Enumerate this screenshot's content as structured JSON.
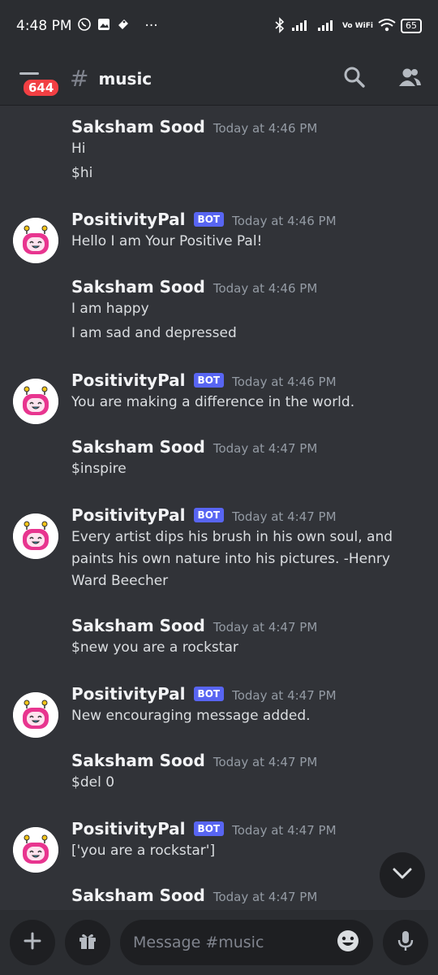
{
  "status_bar": {
    "time": "4:48 PM",
    "more": "···",
    "battery": "65",
    "vowifi": "Vo WiFi"
  },
  "header": {
    "unread_count": "644",
    "hash": "#",
    "channel": "music"
  },
  "messages": [
    {
      "author": "Saksham Sood",
      "bot": false,
      "time": "Today at 4:46 PM",
      "lines": [
        "Hi",
        "$hi"
      ]
    },
    {
      "author": "PositivityPal",
      "bot": true,
      "time": "Today at 4:46 PM",
      "lines": [
        "Hello I am Your Positive Pal!"
      ]
    },
    {
      "author": "Saksham Sood",
      "bot": false,
      "time": "Today at 4:46 PM",
      "lines": [
        "I am happy",
        "I am sad and depressed"
      ]
    },
    {
      "author": "PositivityPal",
      "bot": true,
      "time": "Today at 4:46 PM",
      "lines": [
        "You are making a difference in the world."
      ]
    },
    {
      "author": "Saksham Sood",
      "bot": false,
      "time": "Today at 4:47 PM",
      "lines": [
        "$inspire"
      ]
    },
    {
      "author": "PositivityPal",
      "bot": true,
      "time": "Today at 4:47 PM",
      "lines": [
        "Every artist dips his brush in his own soul, and paints his own nature into his pictures. -Henry Ward Beecher"
      ]
    },
    {
      "author": "Saksham Sood",
      "bot": false,
      "time": "Today at 4:47 PM",
      "lines": [
        "$new you are a rockstar"
      ]
    },
    {
      "author": "PositivityPal",
      "bot": true,
      "time": "Today at 4:47 PM",
      "lines": [
        "New encouraging message added."
      ]
    },
    {
      "author": "Saksham Sood",
      "bot": false,
      "time": "Today at 4:47 PM",
      "lines": [
        "$del 0"
      ]
    },
    {
      "author": "PositivityPal",
      "bot": true,
      "time": "Today at 4:47 PM",
      "lines": [
        "['you are a rockstar']"
      ]
    },
    {
      "author": "Saksham Sood",
      "bot": false,
      "time": "Today at 4:47 PM",
      "lines": []
    }
  ],
  "bot_tag": "BOT",
  "composer": {
    "placeholder": "Message #music"
  },
  "icons": {
    "header": [
      "menu-icon",
      "search-icon",
      "members-icon"
    ],
    "composer": [
      "plus-icon",
      "gift-icon",
      "emoji-icon",
      "microphone-icon"
    ],
    "scroll": "chevron-down-icon"
  },
  "colors": {
    "background": "#313338",
    "header": "#2b2d31",
    "accent": "#5865f2",
    "badge": "#f23f43"
  }
}
